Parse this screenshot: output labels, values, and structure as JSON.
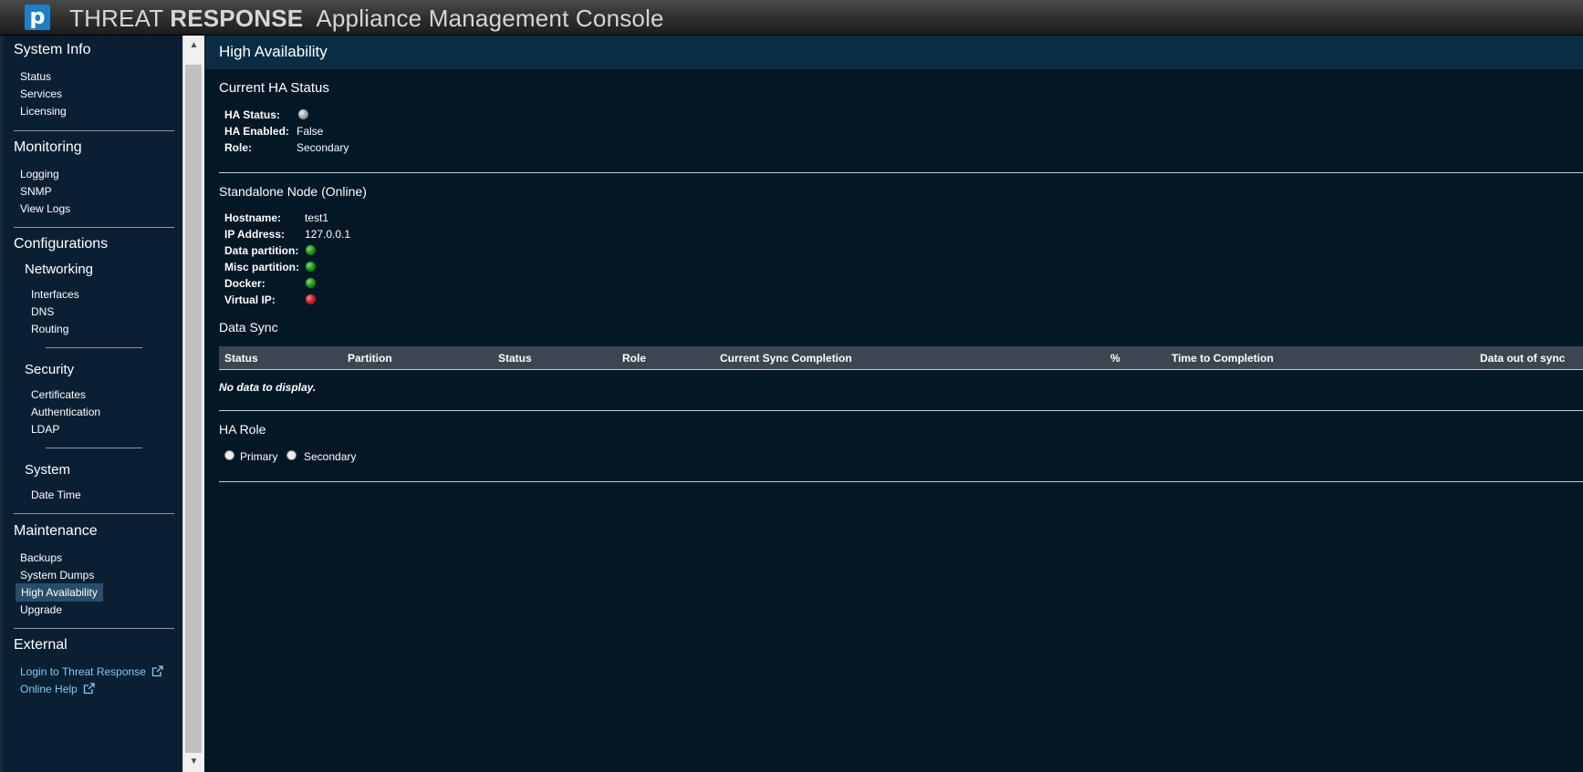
{
  "app": {
    "logo_letter": "p",
    "brand_light": "THREAT ",
    "brand_bold": "RESPONSE",
    "title": "Appliance Management Console"
  },
  "sidebar": {
    "system_info": {
      "heading": "System Info",
      "items": [
        "Status",
        "Services",
        "Licensing"
      ]
    },
    "monitoring": {
      "heading": "Monitoring",
      "items": [
        "Logging",
        "SNMP",
        "View Logs"
      ]
    },
    "configurations": {
      "heading": "Configurations",
      "networking": {
        "heading": "Networking",
        "items": [
          "Interfaces",
          "DNS",
          "Routing"
        ]
      },
      "security": {
        "heading": "Security",
        "items": [
          "Certificates",
          "Authentication",
          "LDAP"
        ]
      },
      "system": {
        "heading": "System",
        "items": [
          "Date Time"
        ]
      }
    },
    "maintenance": {
      "heading": "Maintenance",
      "items": [
        "Backups",
        "System Dumps",
        "High Availability",
        "Upgrade"
      ],
      "active": "High Availability"
    },
    "external": {
      "heading": "External",
      "items": [
        "Login to Threat Response",
        "Online Help"
      ]
    }
  },
  "page": {
    "title": "High Availability",
    "current_status": {
      "heading": "Current HA Status",
      "ha_status_label": "HA Status:",
      "ha_status_indicator": "gray",
      "ha_enabled_label": "HA Enabled:",
      "ha_enabled_value": "False",
      "role_label": "Role:",
      "role_value": "Secondary"
    },
    "node": {
      "heading": "Standalone Node (Online)",
      "hostname_label": "Hostname:",
      "hostname_value": "test1",
      "ip_label": "IP Address:",
      "ip_value": "127.0.0.1",
      "data_partition_label": "Data partition:",
      "data_partition_status": "green",
      "misc_partition_label": "Misc partition:",
      "misc_partition_status": "green",
      "docker_label": "Docker:",
      "docker_status": "green",
      "virtual_ip_label": "Virtual IP:",
      "virtual_ip_status": "red"
    },
    "data_sync": {
      "heading": "Data Sync",
      "columns": [
        "Status",
        "Partition",
        "Status",
        "Role",
        "Current Sync Completion",
        "%",
        "Time to Completion",
        "Data out of sync"
      ],
      "empty_text": "No data to display."
    },
    "ha_role": {
      "heading": "HA Role",
      "options": [
        "Primary",
        "Secondary"
      ]
    }
  },
  "colors": {
    "background": "#041725",
    "sidebar": "#0b1f33",
    "header": "#0a2d45",
    "link": "#7fc9f4",
    "active_item": "#2a4d6d",
    "status_ok": "#1f9a1f",
    "status_error": "#d61f1f",
    "status_unknown": "#a8a8a8"
  }
}
